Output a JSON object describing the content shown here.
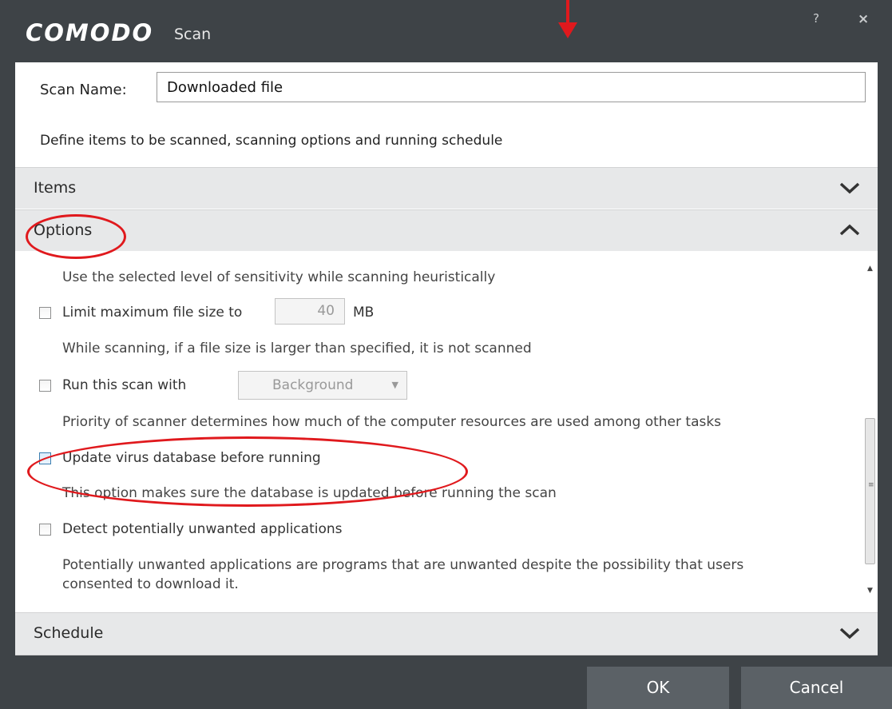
{
  "window": {
    "brand": "COMODO",
    "title": "Scan",
    "help_label": "?",
    "close_label": "×"
  },
  "scan_name": {
    "label": "Scan Name:",
    "value": "Downloaded file"
  },
  "description": "Define items to be scanned, scanning options and running schedule",
  "sections": {
    "items": {
      "label": "Items",
      "state": "collapsed"
    },
    "options": {
      "label": "Options",
      "state": "expanded"
    },
    "schedule": {
      "label": "Schedule",
      "state": "collapsed"
    }
  },
  "options": {
    "heuristics_desc": "Use the selected level of sensitivity while scanning heuristically",
    "limit_size": {
      "label": "Limit maximum file size to",
      "value": "40",
      "unit": "MB",
      "checked": false,
      "desc": "While scanning, if a file size is larger than specified, it is not scanned"
    },
    "run_with": {
      "label": "Run this scan with",
      "selected": "Background",
      "checked": false,
      "desc": "Priority of scanner determines how much of the computer resources are used among other tasks"
    },
    "update_db": {
      "label": "Update virus database before running",
      "checked": false,
      "desc": "This option makes sure the database is updated before running the scan"
    },
    "pua": {
      "label": "Detect potentially unwanted applications",
      "checked": false,
      "desc_line1": "Potentially unwanted applications are programs that are unwanted despite the possibility that users",
      "desc_line2": "consented to download it."
    }
  },
  "footer": {
    "ok_label": "OK",
    "cancel_label": "Cancel"
  },
  "colors": {
    "frame": "#3e4347",
    "button": "#5b6166",
    "section_header": "#e7e8e9",
    "annotation": "#e0191d"
  }
}
